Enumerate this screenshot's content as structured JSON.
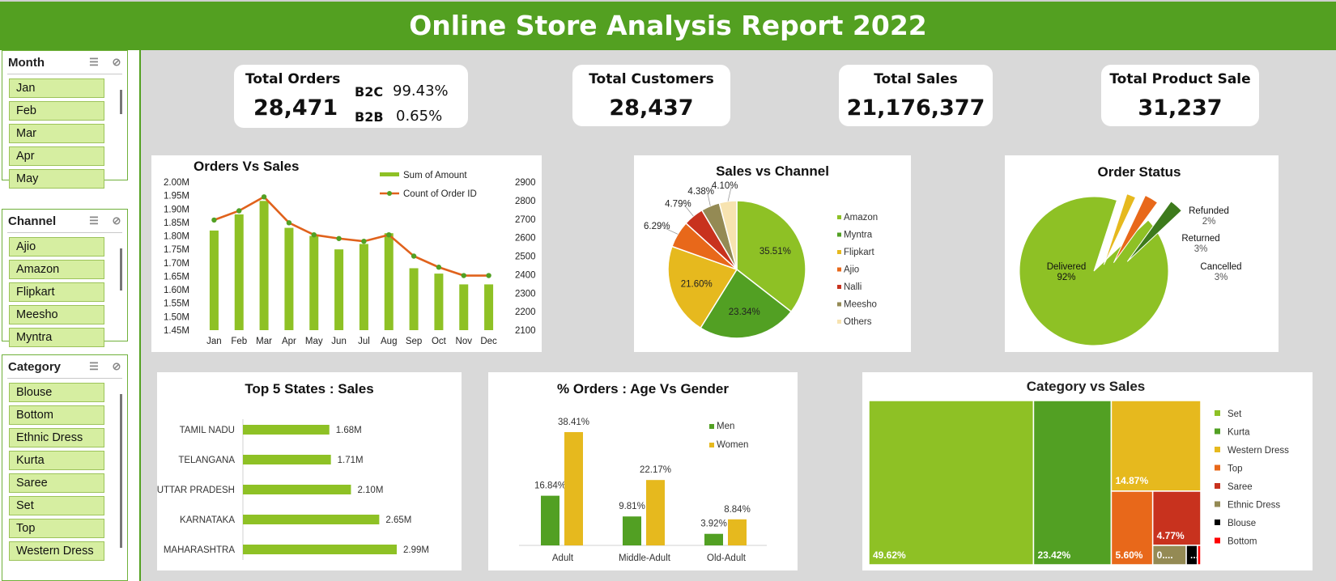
{
  "header": {
    "title": "Online Store Analysis Report 2022"
  },
  "slicers": {
    "month": {
      "title": "Month",
      "items": [
        "Jan",
        "Feb",
        "Mar",
        "Apr",
        "May"
      ]
    },
    "channel": {
      "title": "Channel",
      "items": [
        "Ajio",
        "Amazon",
        "Flipkart",
        "Meesho",
        "Myntra"
      ]
    },
    "category": {
      "title": "Category",
      "items": [
        "Blouse",
        "Bottom",
        "Ethnic Dress",
        "Kurta",
        "Saree",
        "Set",
        "Top",
        "Western Dress"
      ]
    }
  },
  "kpis": {
    "total_orders": {
      "label": "Total Orders",
      "value": "28,471",
      "b2c_label": "B2C",
      "b2c_value": "99.43%",
      "b2b_label": "B2B",
      "b2b_value": "0.65%"
    },
    "total_customers": {
      "label": "Total Customers",
      "value": "28,437"
    },
    "total_sales": {
      "label": "Total Sales",
      "value": "21,176,377"
    },
    "total_product_sale": {
      "label": "Total Product Sale",
      "value": "31,237"
    }
  },
  "colors": {
    "green_light": "#8ec125",
    "green_dark": "#52a023",
    "yellow": "#e6b91e",
    "orange": "#e8681a",
    "red": "#c8321e",
    "olive": "#948a54",
    "cream": "#f7e3b0",
    "line": "#e0621c",
    "dark_green": "#3d7a1c",
    "black": "#000000",
    "bright_red": "#ff0000"
  },
  "chart_data": [
    {
      "id": "orders_vs_sales",
      "type": "bar",
      "title": "Orders Vs Sales",
      "categories": [
        "Jan",
        "Feb",
        "Mar",
        "Apr",
        "May",
        "Jun",
        "Jul",
        "Aug",
        "Sep",
        "Oct",
        "Nov",
        "Dec"
      ],
      "series": [
        {
          "name": "Sum of Amount",
          "type": "bar",
          "axis": "left",
          "values": [
            1.82,
            1.88,
            1.93,
            1.83,
            1.8,
            1.75,
            1.77,
            1.81,
            1.68,
            1.66,
            1.62,
            1.62
          ]
        },
        {
          "name": "Count of Order ID",
          "type": "line",
          "axis": "right",
          "values": [
            2695,
            2745,
            2820,
            2680,
            2615,
            2595,
            2580,
            2615,
            2500,
            2440,
            2395,
            2395
          ]
        }
      ],
      "y_left_ticks": [
        "2.00M",
        "1.95M",
        "1.90M",
        "1.85M",
        "1.80M",
        "1.75M",
        "1.70M",
        "1.65M",
        "1.60M",
        "1.55M",
        "1.50M",
        "1.45M"
      ],
      "ylim_left": [
        1.45,
        2.0
      ],
      "y_right_ticks": [
        "2900",
        "2800",
        "2700",
        "2600",
        "2500",
        "2400",
        "2300",
        "2200",
        "2100"
      ],
      "ylim_right": [
        2100,
        2900
      ],
      "legend_position": "top-right"
    },
    {
      "id": "sales_vs_channel",
      "type": "pie",
      "title": "Sales vs Channel",
      "slices": [
        {
          "name": "Amazon",
          "value": 35.51,
          "label": "35.51%"
        },
        {
          "name": "Myntra",
          "value": 23.34,
          "label": "23.34%"
        },
        {
          "name": "Flipkart",
          "value": 21.6,
          "label": "21.60%"
        },
        {
          "name": "Ajio",
          "value": 6.29,
          "label": "6.29%"
        },
        {
          "name": "Nalli",
          "value": 4.79,
          "label": "4.79%"
        },
        {
          "name": "Meesho",
          "value": 4.38,
          "label": "4.38%"
        },
        {
          "name": "Others",
          "value": 4.1,
          "label": "4.10%"
        }
      ],
      "legend_position": "right"
    },
    {
      "id": "order_status",
      "type": "pie",
      "title": "Order Status",
      "slices": [
        {
          "name": "Delivered",
          "value": 92,
          "label": "92%"
        },
        {
          "name": "Refunded",
          "value": 2,
          "label": "2%"
        },
        {
          "name": "Returned",
          "value": 3,
          "label": "3%"
        },
        {
          "name": "Cancelled",
          "value": 3,
          "label": "3%"
        }
      ]
    },
    {
      "id": "top5_states",
      "type": "bar",
      "orientation": "horizontal",
      "title": "Top 5 States : Sales",
      "categories": [
        "TAMIL NADU",
        "TELANGANA",
        "UTTAR PRADESH",
        "KARNATAKA",
        "MAHARASHTRA"
      ],
      "values": [
        1.68,
        1.71,
        2.1,
        2.65,
        2.99
      ],
      "labels": [
        "1.68M",
        "1.71M",
        "2.10M",
        "2.65M",
        "2.99M"
      ]
    },
    {
      "id": "age_vs_gender",
      "type": "bar",
      "title": "% Orders : Age Vs Gender",
      "categories": [
        "Adult",
        "Middle-Adult",
        "Old-Adult"
      ],
      "series": [
        {
          "name": "Men",
          "values": [
            16.84,
            9.81,
            3.92
          ],
          "labels": [
            "16.84%",
            "9.81%",
            "3.92%"
          ]
        },
        {
          "name": "Women",
          "values": [
            38.41,
            22.17,
            8.84
          ],
          "labels": [
            "38.41%",
            "22.17%",
            "8.84%"
          ]
        }
      ],
      "legend_position": "top-right"
    },
    {
      "id": "category_vs_sales",
      "type": "treemap",
      "title": "Category vs Sales",
      "items": [
        {
          "name": "Set",
          "value": 49.62,
          "label": "49.62%"
        },
        {
          "name": "Kurta",
          "value": 23.42,
          "label": "23.42%"
        },
        {
          "name": "Western Dress",
          "value": 14.87,
          "label": "14.87%"
        },
        {
          "name": "Top",
          "value": 5.6,
          "label": "5.60%"
        },
        {
          "name": "Saree",
          "value": 4.77,
          "label": "4.77%"
        },
        {
          "name": "Ethnic Dress",
          "value": 1.2,
          "label": "0...."
        },
        {
          "name": "Blouse",
          "value": 0.4,
          "label": "..."
        },
        {
          "name": "Bottom",
          "value": 0.12,
          "label": ""
        }
      ],
      "legend_position": "right"
    }
  ]
}
